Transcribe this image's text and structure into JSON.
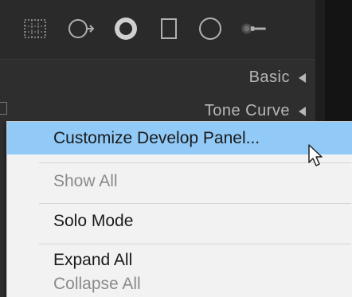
{
  "toolbar": {
    "tools": [
      {
        "icon": "crop-overlay-icon"
      },
      {
        "icon": "spot-removal-icon"
      },
      {
        "icon": "red-eye-icon"
      },
      {
        "icon": "graduated-filter-icon"
      },
      {
        "icon": "radial-filter-icon"
      },
      {
        "icon": "adjustment-brush-icon"
      }
    ]
  },
  "panels": {
    "basic_label": "Basic",
    "tone_curve_label": "Tone Curve"
  },
  "context_menu": {
    "items": [
      {
        "label": "Customize Develop Panel...",
        "state": "highlighted"
      },
      {
        "label": "Show All",
        "state": "disabled"
      },
      {
        "label": "Solo Mode",
        "state": "normal"
      },
      {
        "label": "Expand All",
        "state": "normal"
      },
      {
        "label": "Collapse All",
        "state": "disabled"
      }
    ]
  },
  "colors": {
    "panel_bg": "#2e2e2e",
    "menu_bg": "#f2f2f2",
    "highlight": "#91c9f7",
    "disabled_text": "#8a8a8a"
  }
}
